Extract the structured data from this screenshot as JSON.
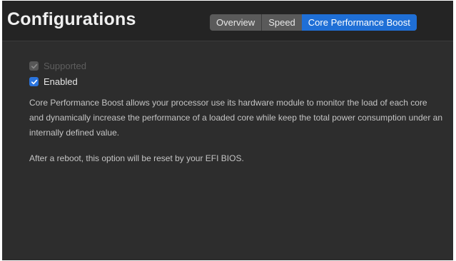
{
  "header": {
    "title": "Configurations",
    "tabs": [
      {
        "label": "Overview",
        "active": false
      },
      {
        "label": "Speed",
        "active": false
      },
      {
        "label": "Core Performance Boost",
        "active": true
      }
    ]
  },
  "options": {
    "supported": {
      "label": "Supported",
      "checked": true,
      "disabled": true
    },
    "enabled": {
      "label": "Enabled",
      "checked": true,
      "disabled": false
    }
  },
  "description": "Core Performance Boost allows your processor use its hardware module to monitor the load of each core and dynamically increase the performance of a loaded core while keep the total power consumption under an internally defined value.",
  "note": "After a reboot, this option will be reset by your EFI BIOS.",
  "colors": {
    "accent": "#1f6fd6",
    "background": "#2d2d2d",
    "header_background": "#242424"
  },
  "icons": {
    "checkmark": "checkmark-icon"
  }
}
